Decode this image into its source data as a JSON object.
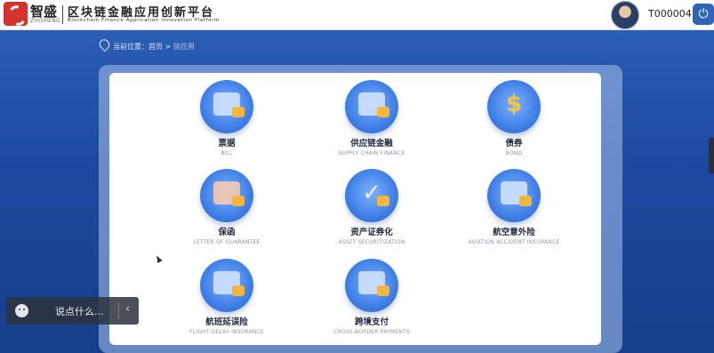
{
  "header": {
    "brand_cn": "智盛",
    "brand_en": "ZHISHENG",
    "platform_cn": "区块链金融应用创新平台",
    "platform_en": "Blockchain Finance Application Innovation Platform",
    "user_id": "T000004",
    "power_icon": "power-icon"
  },
  "breadcrumb": {
    "prefix": "当前位置：",
    "home": "首页 >",
    "current": "链应用"
  },
  "apps": [
    {
      "title": "票据",
      "subtitle": "BILL",
      "icon": "bill-icon"
    },
    {
      "title": "供应链金融",
      "subtitle": "SUPPLY CHAIN FINANCE",
      "icon": "supply-chain-icon"
    },
    {
      "title": "债券",
      "subtitle": "BOND",
      "icon": "bond-icon"
    },
    {
      "title": "保函",
      "subtitle": "LETTER OF GUARANTEE",
      "icon": "guarantee-icon"
    },
    {
      "title": "资产证券化",
      "subtitle": "ASSET SECURITIZATION",
      "icon": "securitization-icon"
    },
    {
      "title": "航空意外险",
      "subtitle": "AVIATION ACCIDENT INSURANCE",
      "icon": "aviation-insurance-icon"
    },
    {
      "title": "航班延误险",
      "subtitle": "FLIGHT DELAY INSURANCE",
      "icon": "flight-delay-icon"
    },
    {
      "title": "跨境支付",
      "subtitle": "CROSS-BORDER PAYMENTS",
      "icon": "cross-border-icon"
    }
  ],
  "chat": {
    "placeholder": "说点什么..."
  },
  "colors": {
    "accent": "#2f63b8",
    "background": "#1c4aa0"
  }
}
